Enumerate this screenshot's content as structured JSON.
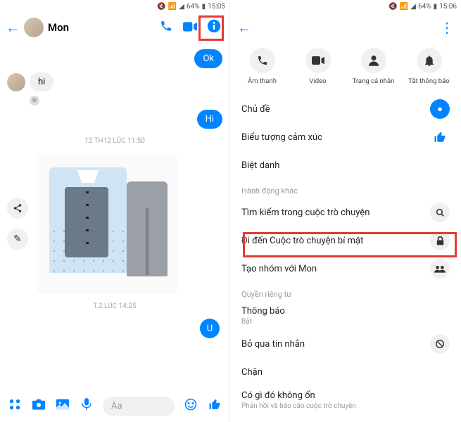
{
  "status": {
    "battery": "64%",
    "time_left": "15:05",
    "time_right": "15:06"
  },
  "left": {
    "contact": "Mon",
    "msgs": {
      "ok": "Ok",
      "hi_in": "hi",
      "hi_out": "Hi",
      "u": "U"
    },
    "ts1": "12 TH12 LÚC 11:50",
    "ts2": "T.2 LÚC 14:25",
    "composer_placeholder": "Aa"
  },
  "right": {
    "actions": {
      "audio": "Âm thanh",
      "video": "Video",
      "profile": "Trang cá nhân",
      "mute": "Tắt thông báo"
    },
    "menu": {
      "theme": "Chủ đề",
      "emoji": "Biểu tượng cảm xúc",
      "nickname": "Biệt danh",
      "section_more": "Hành động khác",
      "search": "Tìm kiếm trong cuộc trò chuyện",
      "secret": "Đi đến Cuộc trò chuyện bí mật",
      "group": "Tạo nhóm với Mon",
      "section_privacy": "Quyền riêng tư",
      "notif": "Thông báo",
      "notif_sub": "Bật",
      "ignore": "Bỏ qua tin nhắn",
      "block": "Chặn",
      "wrong": "Có gì đó không ổn",
      "wrong_sub": "Phản hồi và báo cáo cuộc trò chuyện"
    }
  }
}
